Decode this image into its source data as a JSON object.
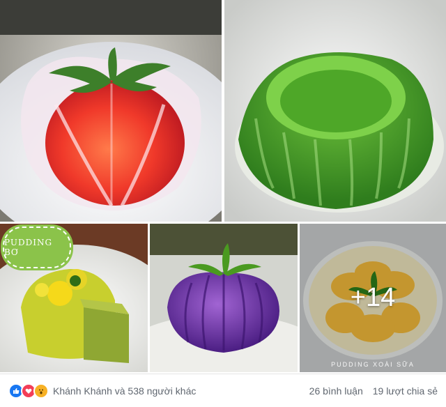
{
  "photos": {
    "tile3_badge": "PUDDING BƠ",
    "tile5_more": "+14",
    "tile5_watermark": "PUDDING XOÀI SỮA"
  },
  "footer": {
    "reactions": [
      "like-icon",
      "love-icon",
      "wow-icon"
    ],
    "reaction_text": "Khánh Khánh và 538 người khác",
    "comments": "26 bình luận",
    "shares": "19 lượt chia sẻ"
  },
  "colors": {
    "like": "#1877f2",
    "love": "#f33e58",
    "wow": "#f7b125",
    "text": "#606770"
  }
}
